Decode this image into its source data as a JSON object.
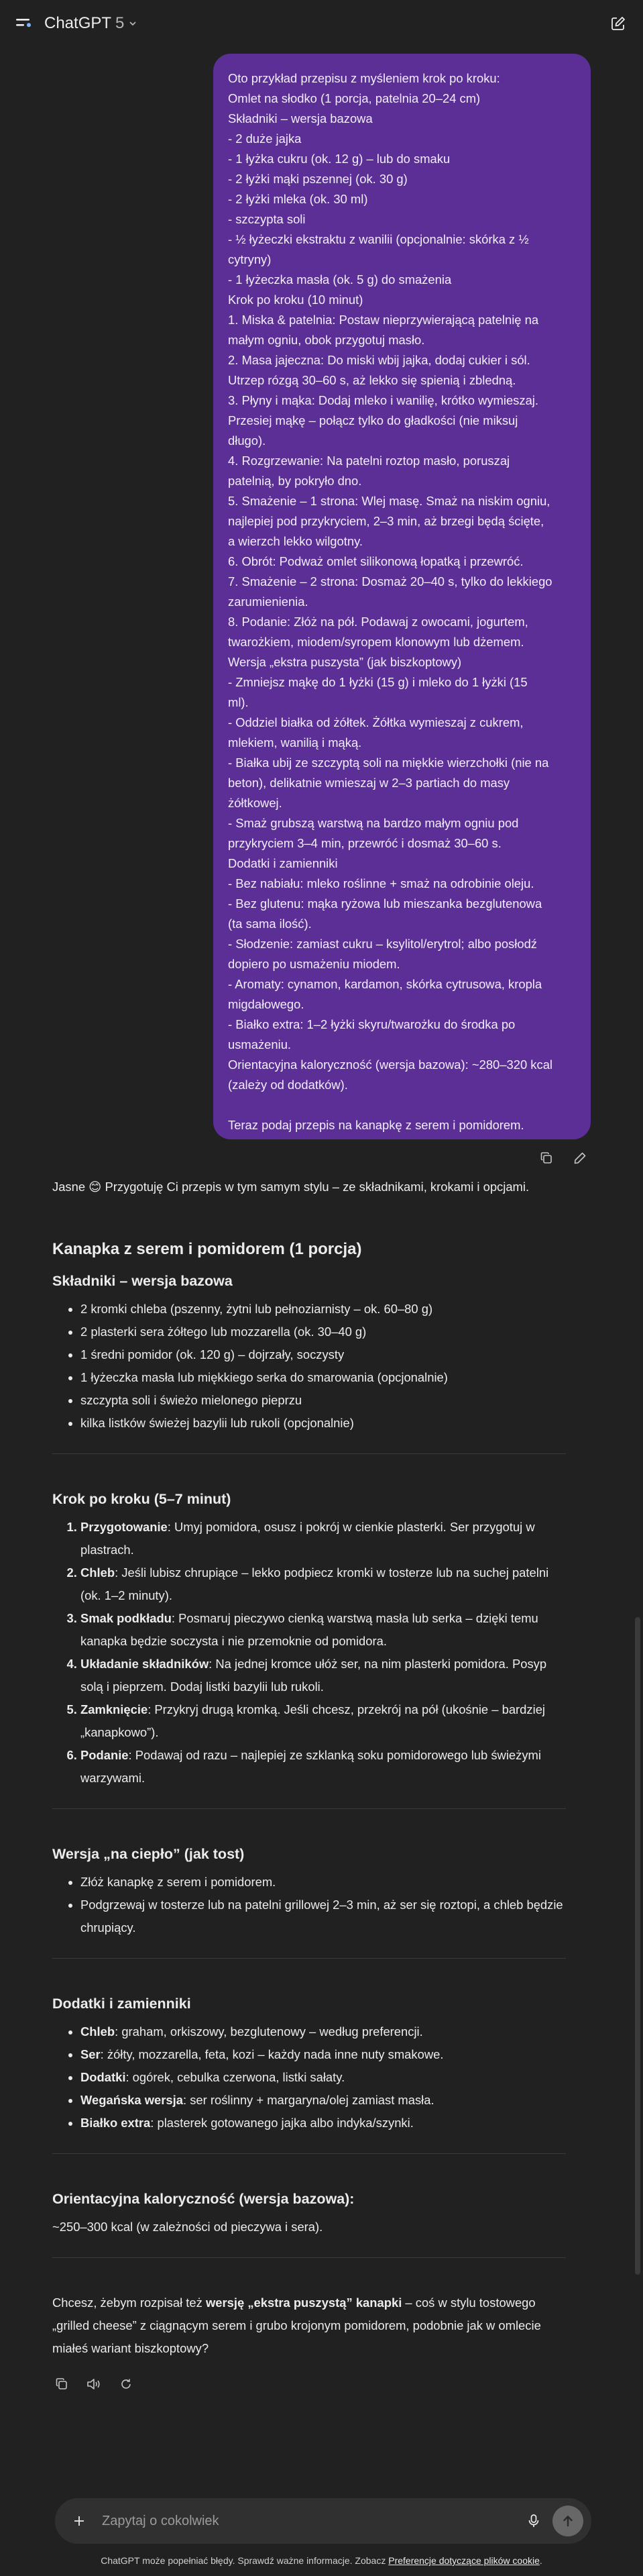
{
  "header": {
    "app_name": "ChatGPT",
    "model_version": "5"
  },
  "user_message": {
    "lines": [
      "Oto przykład przepisu z myśleniem krok po kroku:",
      "Omlet na słodko (1 porcja, patelnia 20–24 cm)",
      "Składniki – wersja bazowa",
      "- 2 duże jajka",
      "- 1 łyżka cukru (ok. 12 g) – lub do smaku",
      "- 2 łyżki mąki pszennej (ok. 30 g)",
      "- 2 łyżki mleka (ok. 30 ml)",
      "- szczypta soli",
      "- ½ łyżeczki ekstraktu z wanilii (opcjonalnie: skórka z ½",
      "cytryny)",
      "- 1 łyżeczka masła (ok. 5 g) do smażenia",
      "Krok po kroku (10 minut)",
      "1. Miska & patelnia: Postaw nieprzywierającą patelnię na",
      "małym ogniu, obok przygotuj masło.",
      "2. Masa jajeczna: Do miski wbij jajka, dodaj cukier i sól.",
      "Utrzep rózgą 30–60 s, aż lekko się spienią i zbledną.",
      "3. Płyny i mąka: Dodaj mleko i wanilię, krótko wymieszaj.",
      "Przesiej mąkę – połącz tylko do gładkości (nie miksuj",
      "długo).",
      "4. Rozgrzewanie: Na patelni roztop masło, poruszaj",
      "patelnią, by pokryło dno.",
      "5. Smażenie – 1 strona: Wlej masę. Smaż na niskim ogniu,",
      "najlepiej pod przykryciem, 2–3 min, aż brzegi będą ścięte,",
      "a wierzch lekko wilgotny.",
      "6. Obrót: Podważ omlet silikonową łopatką i przewróć.",
      "7. Smażenie – 2 strona: Dosmaż 20–40 s, tylko do lekkiego",
      "zarumienienia.",
      "8. Podanie: Złóż na pół. Podawaj z owocami, jogurtem,",
      "twarożkiem, miodem/syropem klonowym lub dżemem.",
      "Wersja „ekstra puszysta” (jak biszkoptowy)",
      "- Zmniejsz mąkę do 1 łyżki (15 g) i mleko do 1 łyżki (15",
      "ml).",
      "- Oddziel białka od żółtek. Żółtka wymieszaj z cukrem,",
      "mlekiem, wanilią i mąką.",
      "- Białka ubij ze szczyptą soli na miękkie wierzchołki (nie na",
      "beton), delikatnie wmieszaj w 2–3 partiach do masy",
      "żółtkowej.",
      "- Smaż grubszą warstwą na bardzo małym ogniu pod",
      "przykryciem 3–4 min, przewróć i dosmaż 30–60 s.",
      "Dodatki i zamienniki",
      "- Bez nabiału: mleko roślinne + smaż na odrobinie oleju.",
      "- Bez glutenu: mąka ryżowa lub mieszanka bezglutenowa",
      "(ta sama ilość).",
      "- Słodzenie: zamiast cukru – ksylitol/erytrol; albo posłodź",
      "dopiero po usmażeniu miodem.",
      "- Aromaty: cynamon, kardamon, skórka cytrusowa, kropla",
      "migdałowego.",
      "- Białko extra: 1–2 łyżki skyru/twarożku do środka po",
      "usmażeniu.",
      "Orientacyjna kaloryczność (wersja bazowa): ~280–320 kcal",
      "(zależy od dodatków).",
      "",
      "Teraz podaj przepis na kanapkę z serem i pomidorem."
    ]
  },
  "answer": {
    "intro": "Jasne 😊 Przygotuję Ci przepis w tym samym stylu – ze składnikami, krokami i opcjami.",
    "title": "Kanapka z serem i pomidorem (1 porcja)",
    "ingredients_heading": "Składniki – wersja bazowa",
    "ingredients": [
      "2 kromki chleba (pszenny, żytni lub pełnoziarnisty – ok. 60–80 g)",
      "2 plasterki sera żółtego lub mozzarella (ok. 30–40 g)",
      "1 średni pomidor (ok. 120 g) – dojrzały, soczysty",
      "1 łyżeczka masła lub miękkiego serka do smarowania (opcjonalnie)",
      "szczypta soli i świeżo mielonego pieprzu",
      "kilka listków świeżej bazylii lub rukoli (opcjonalnie)"
    ],
    "steps_heading": "Krok po kroku (5–7 minut)",
    "steps": [
      {
        "label": "Przygotowanie",
        "text": ": Umyj pomidora, osusz i pokrój w cienkie plasterki. Ser przygotuj w plastrach."
      },
      {
        "label": "Chleb",
        "text": ": Jeśli lubisz chrupiące – lekko podpiecz kromki w tosterze lub na suchej patelni (ok. 1–2 minuty)."
      },
      {
        "label": "Smak podkładu",
        "text": ": Posmaruj pieczywo cienką warstwą masła lub serka – dzięki temu kanapka będzie soczysta i nie przemoknie od pomidora."
      },
      {
        "label": "Układanie składników",
        "text": ": Na jednej kromce ułóż ser, na nim plasterki pomidora. Posyp solą i pieprzem. Dodaj listki bazylii lub rukoli."
      },
      {
        "label": "Zamknięcie",
        "text": ": Przykryj drugą kromką. Jeśli chcesz, przekrój na pół (ukośnie – bardziej „kanapkowo”)."
      },
      {
        "label": "Podanie",
        "text": ": Podawaj od razu – najlepiej ze szklanką soku pomidorowego lub świeżymi warzywami."
      }
    ],
    "warm_heading": "Wersja „na ciepło” (jak tost)",
    "warm": [
      "Złóż kanapkę z serem i pomidorem.",
      "Podgrzewaj w tosterze lub na patelni grillowej 2–3 min, aż ser się roztopi, a chleb będzie chrupiący."
    ],
    "extras_heading": "Dodatki i zamienniki",
    "extras": [
      {
        "label": "Chleb",
        "text": ": graham, orkiszowy, bezglutenowy – według preferencji."
      },
      {
        "label": "Ser",
        "text": ": żółty, mozzarella, feta, kozi – każdy nada inne nuty smakowe."
      },
      {
        "label": "Dodatki",
        "text": ": ogórek, cebulka czerwona, listki sałaty."
      },
      {
        "label": "Wegańska wersja",
        "text": ": ser roślinny + margaryna/olej zamiast masła."
      },
      {
        "label": "Białko extra",
        "text": ": plasterek gotowanego jajka albo indyka/szynki."
      }
    ],
    "calories_heading": "Orientacyjna kaloryczność (wersja bazowa):",
    "calories_text": "~250–300 kcal (w zależności od pieczywa i sera).",
    "followup_before": "Chcesz, żebym rozpisał też ",
    "followup_bold": "wersję „ekstra puszystą” kanapki",
    "followup_after": " – coś w stylu tostowego „grilled cheese” z ciągnącym serem i grubo krojonym pomidorem, podobnie jak w omlecie miałeś wariant biszkoptowy?"
  },
  "composer": {
    "placeholder": "Zapytaj o cokolwiek"
  },
  "footer": {
    "disclaimer": "ChatGPT może popełniać błędy. Sprawdź ważne informacje. Zobacz ",
    "link": "Preferencje dotyczące plików cookie",
    "end": "."
  }
}
